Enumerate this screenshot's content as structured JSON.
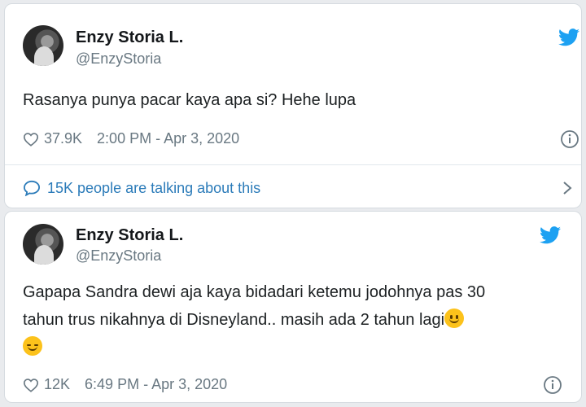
{
  "tweets": [
    {
      "name": "Enzy Storia L.",
      "handle": "@EnzyStoria",
      "text": "Rasanya punya pacar kaya apa si? Hehe lupa",
      "likes": "37.9K",
      "timestamp": "2:00 PM - Apr 3, 2020",
      "talking": "15K people are talking about this"
    },
    {
      "name": "Enzy Storia L.",
      "handle": "@EnzyStoria",
      "text_line1": "Gapapa Sandra dewi aja kaya bidadari ketemu jodohnya pas 30",
      "text_line2": "tahun trus nikahnya di Disneyland.. masih ada 2 tahun lagi",
      "emojis": [
        "slightly-smiling-face",
        "relieved-face"
      ],
      "likes": "12K",
      "timestamp": "6:49 PM - Apr 3, 2020"
    }
  ],
  "icons": {
    "bird": "twitter-bird-icon",
    "heart": "heart-icon",
    "info": "info-icon",
    "bubble": "speech-bubble-icon",
    "chevron": "chevron-right-icon"
  },
  "colors": {
    "twitter_blue": "#1da1f2",
    "link_blue": "#2b7bb9",
    "muted": "#697882"
  }
}
